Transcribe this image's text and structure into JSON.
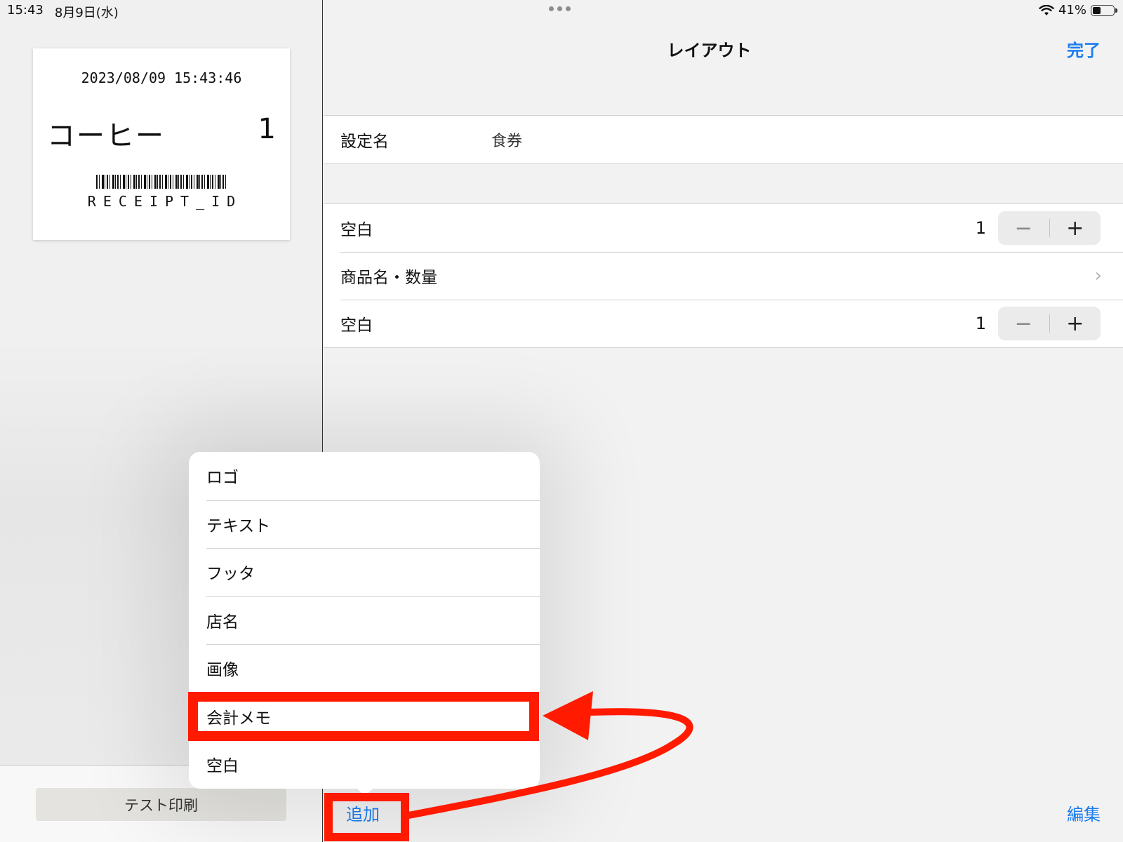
{
  "status_bar": {
    "time": "15:43",
    "date": "8月9日(水)",
    "battery_percent": "41%",
    "battery_level": 0.41
  },
  "receipt_preview": {
    "datetime": "2023/08/09 15:43:46",
    "product": "コーヒー",
    "quantity": "1",
    "receipt_id": "RECEIPT_ID"
  },
  "left_toolbar": {
    "test_print_label": "テスト印刷"
  },
  "nav": {
    "title": "レイアウト",
    "done_label": "完了"
  },
  "settings": {
    "name_label": "設定名",
    "name_value": "食券"
  },
  "layout_rows": [
    {
      "label": "空白",
      "value": "1",
      "minus": "−",
      "plus": "+"
    },
    {
      "label": "商品名・数量",
      "chevron": "›"
    },
    {
      "label": "空白",
      "value": "1",
      "minus": "−",
      "plus": "+"
    }
  ],
  "bottom_toolbar": {
    "add_label": "追加",
    "edit_label": "編集"
  },
  "add_menu": {
    "items": [
      "ロゴ",
      "テキスト",
      "フッタ",
      "店名",
      "画像",
      "会計メモ",
      "空白"
    ],
    "highlighted_index": 5
  },
  "colors": {
    "accent": "#1a7cf0",
    "annotation": "#ff1a00"
  },
  "icons": {
    "wifi": "wifi-icon",
    "battery": "battery-icon",
    "chevron": "chevron-right-icon",
    "minus": "minus-icon",
    "plus": "plus-icon"
  }
}
